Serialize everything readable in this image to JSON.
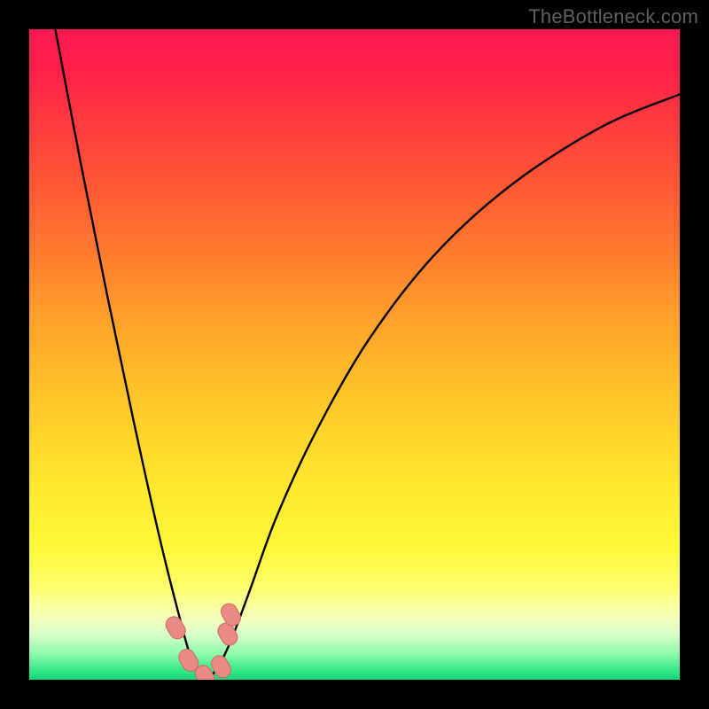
{
  "watermark": "TheBottleneck.com",
  "colors": {
    "gradient_top": "#ff1a52",
    "gradient_mid": "#ffc929",
    "gradient_bottom": "#1bd276",
    "curve": "#000000",
    "marker_fill": "#e98b84",
    "marker_stroke": "#c76a63",
    "frame": "#000000"
  },
  "chart_data": {
    "type": "line",
    "title": "",
    "xlabel": "",
    "ylabel": "",
    "xlim": [
      0,
      100
    ],
    "ylim": [
      0,
      100
    ],
    "grid": false,
    "legend": false,
    "notes": "V-shaped bottleneck curve. y-axis is inverted visually (0 at bottom = green/good, 100 at top = red/bad). Minimum near x≈27 where y≈0.",
    "series": [
      {
        "name": "bottleneck-curve",
        "x": [
          4,
          8,
          12,
          16,
          20,
          23,
          25,
          27,
          29,
          31,
          34,
          38,
          44,
          52,
          62,
          74,
          88,
          100
        ],
        "y": [
          100,
          79,
          59,
          40,
          22,
          10,
          3,
          0,
          2,
          6,
          14,
          25,
          38,
          52,
          65,
          76,
          85,
          90
        ]
      }
    ],
    "markers": [
      {
        "x": 22.5,
        "y": 8
      },
      {
        "x": 24.5,
        "y": 3
      },
      {
        "x": 27.0,
        "y": 0.5
      },
      {
        "x": 29.5,
        "y": 2
      },
      {
        "x": 30.5,
        "y": 7
      },
      {
        "x": 31.0,
        "y": 10
      }
    ]
  }
}
